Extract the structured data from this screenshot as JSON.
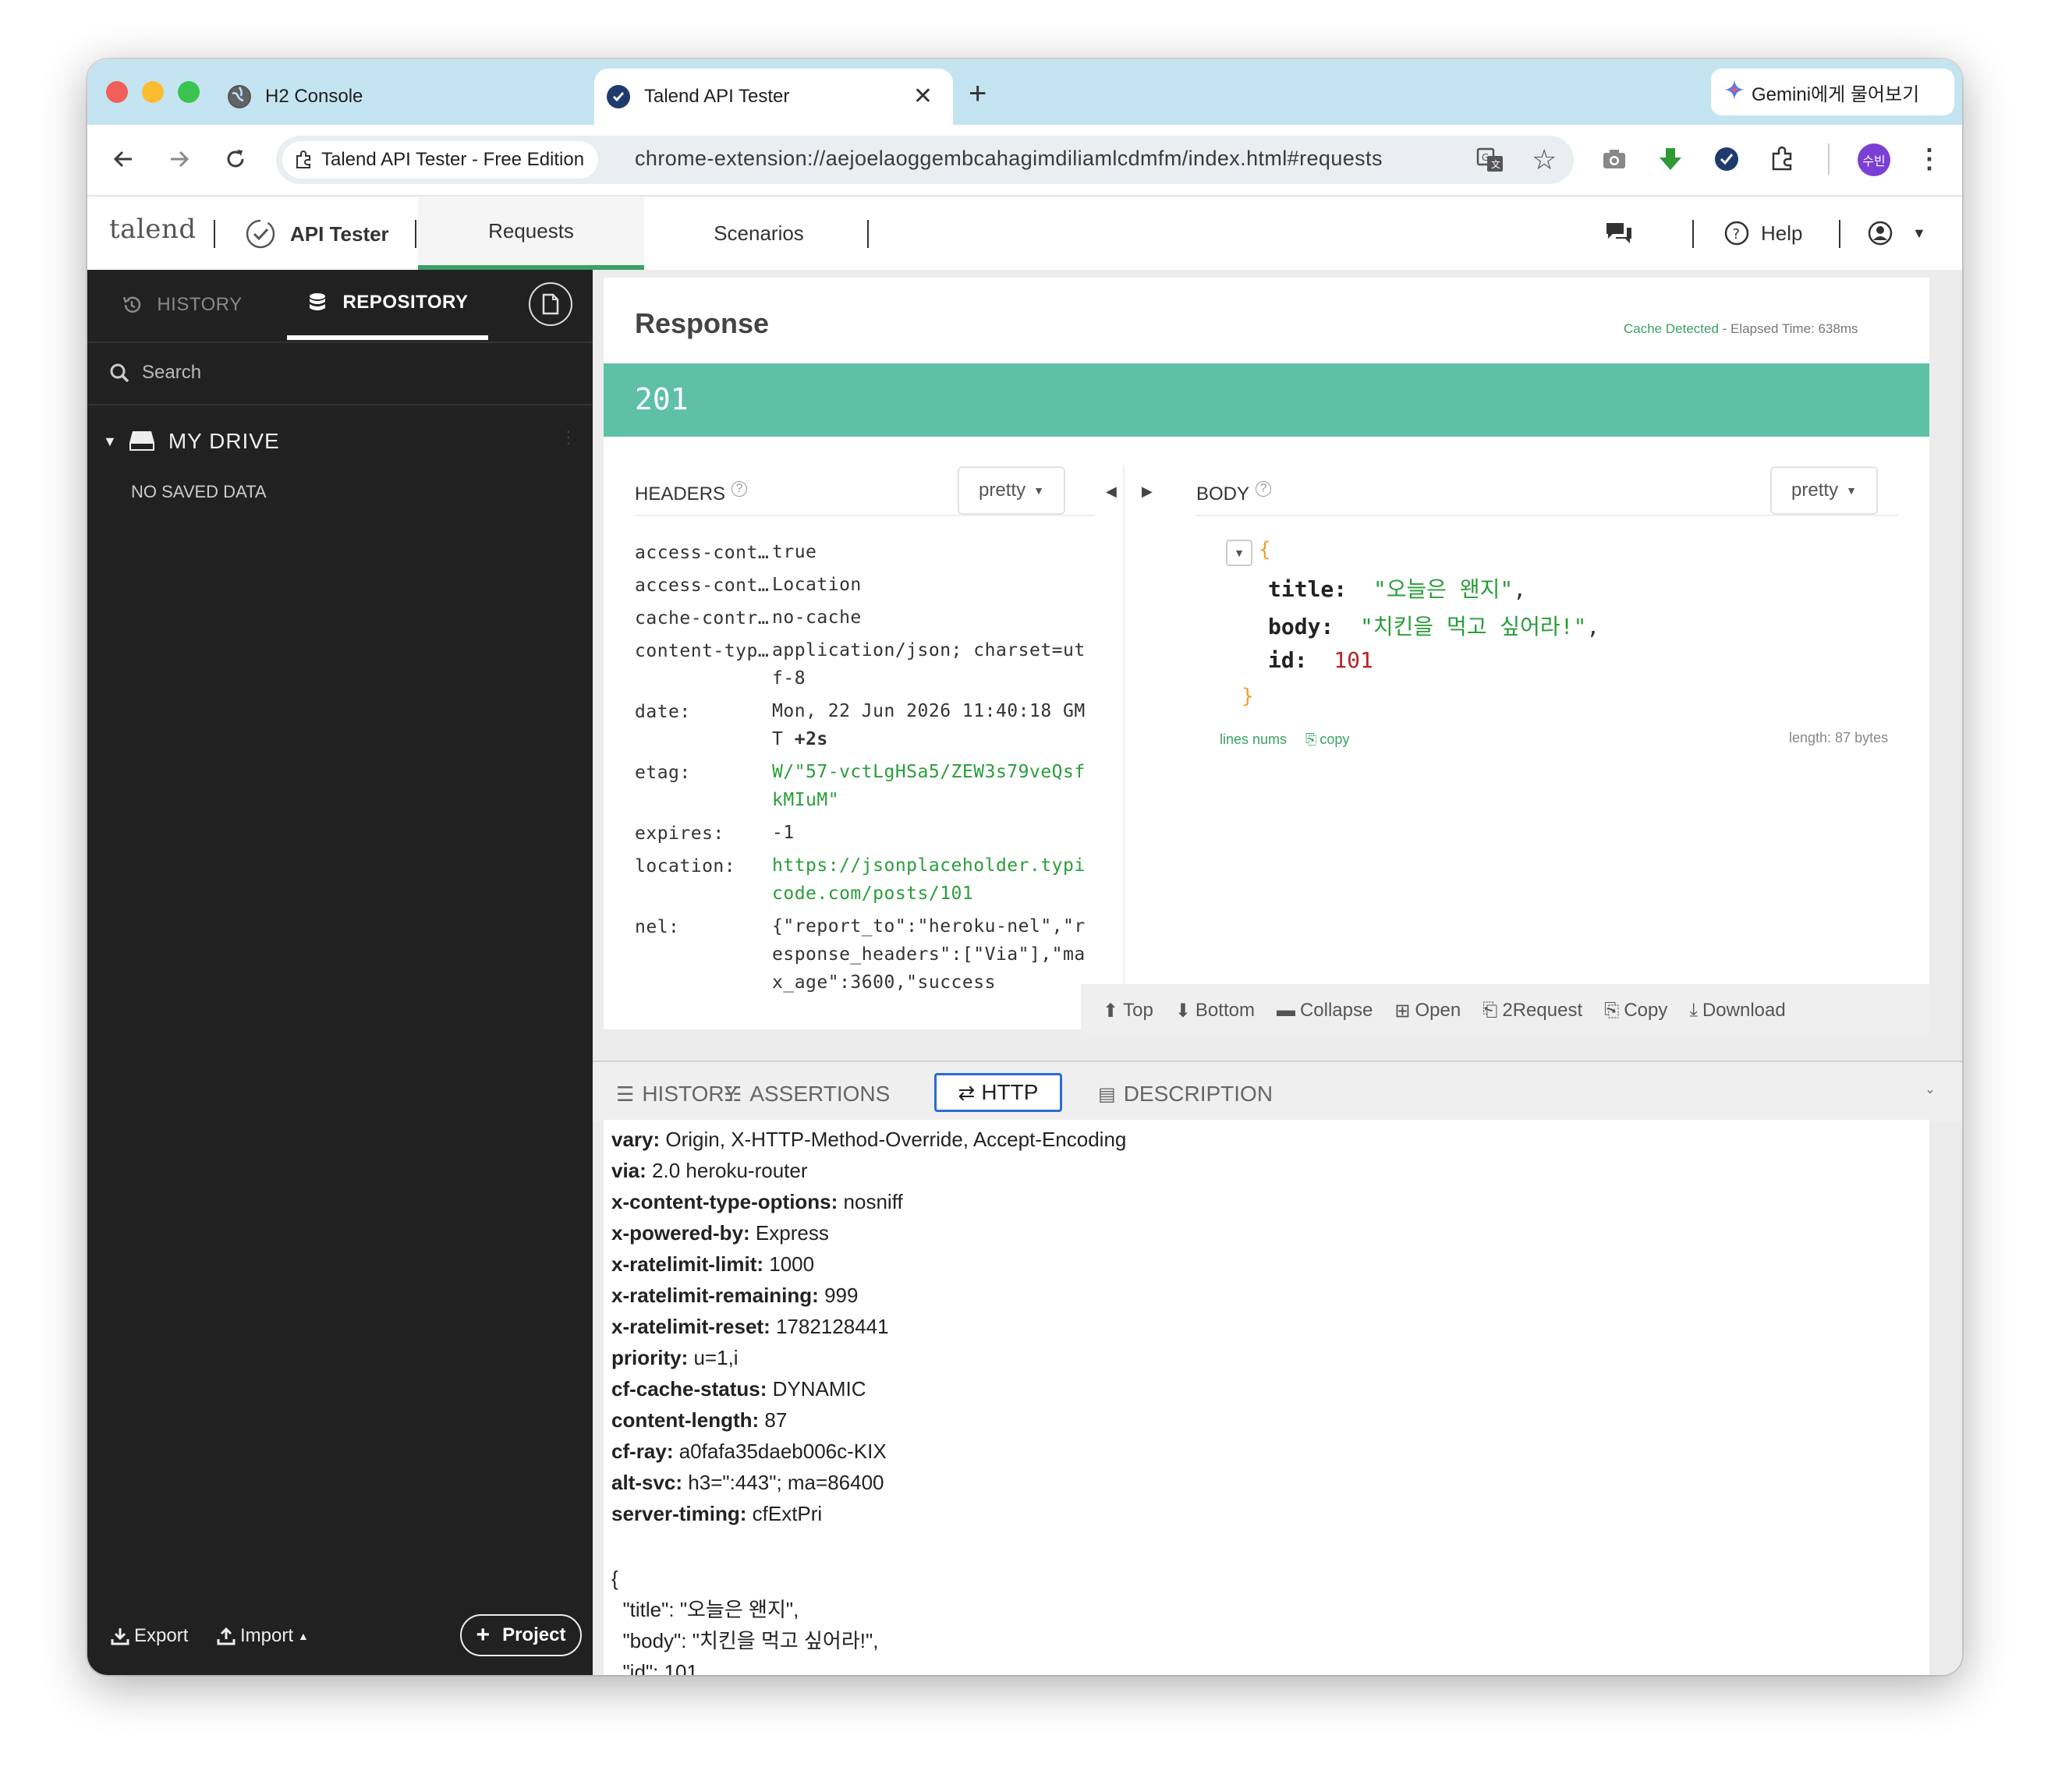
{
  "browser": {
    "tabs": [
      {
        "title": "H2 Console",
        "active": false
      },
      {
        "title": "Talend API Tester",
        "active": true
      }
    ],
    "new_tab": "+",
    "gemini_label": "Gemini에게 물어보기",
    "site_chip": "Talend API Tester - Free Edition",
    "url": "chrome-extension://aejoelaoggembcahagimdiliamlcdmfm/index.html#requests",
    "avatar_text": "수빈",
    "colors": {
      "tab_strip": "#c5e4f1",
      "download_icon": "#2e9a35",
      "avatar": "#7b3fd6"
    }
  },
  "app": {
    "logo": "talend",
    "product": "API Tester",
    "nav": [
      "Requests",
      "Scenarios"
    ],
    "help": "Help",
    "accent": "#3aa067"
  },
  "sidebar": {
    "tabs": [
      "HISTORY",
      "REPOSITORY"
    ],
    "active_tab": "REPOSITORY",
    "search_placeholder": "Search",
    "drive_label": "MY DRIVE",
    "empty_text": "NO SAVED DATA",
    "footer": {
      "export": "Export",
      "import": "Import",
      "project": "Project"
    }
  },
  "response": {
    "title": "Response",
    "cache_detected": "Cache Detected",
    "elapsed": "- Elapsed Time: 638ms",
    "status_code": "201",
    "status_color": "#5ec0a5",
    "headers_label": "HEADERS",
    "body_label": "BODY",
    "headers_format": "pretty",
    "body_format": "pretty",
    "headers": [
      {
        "key": "access-cont…",
        "value": "true"
      },
      {
        "key": "access-cont…",
        "value": "Location"
      },
      {
        "key": "cache-contr…",
        "value": "no-cache"
      },
      {
        "key": "content-typ…",
        "value": "application/json; charset=utf-8"
      },
      {
        "key": "date:",
        "value": "Mon, 22 Jun 2026 11:40:18 GMT",
        "extra": "+2s"
      },
      {
        "key": "etag:",
        "value": "W/\"57-vctLgHSa5/ZEW3s79veQsfkMIuM\""
      },
      {
        "key": "expires:",
        "value": "-1"
      },
      {
        "key": "location:",
        "value": "https://jsonplaceholder.typicode.com/posts/101"
      },
      {
        "key": "nel:",
        "value": "{\"report_to\":\"heroku-nel\",\"response_headers\":[\"Via\"],\"max_age\":3600,\"success"
      }
    ],
    "body_json": {
      "open": "{",
      "close": "}",
      "fields": [
        {
          "key": "title",
          "value": "\"오늘은 왠지\"",
          "sep": ","
        },
        {
          "key": "body",
          "value": "\"치킨을 먹고 싶어라!\"",
          "sep": ","
        },
        {
          "key": "id",
          "value": "101",
          "sep": ""
        }
      ]
    },
    "lines_nums": "lines nums",
    "copy_link": "copy",
    "length": "length: 87 bytes",
    "actions": [
      "Top",
      "Bottom",
      "Collapse",
      "Open",
      "2Request",
      "Copy",
      "Download"
    ]
  },
  "bottom": {
    "tabs": [
      "HISTORY",
      "ASSERTIONS",
      "HTTP",
      "DESCRIPTION"
    ],
    "active_tab": "HTTP",
    "http_headers": [
      {
        "k": "vary:",
        "v": "Origin, X-HTTP-Method-Override, Accept-Encoding"
      },
      {
        "k": "via:",
        "v": "2.0 heroku-router"
      },
      {
        "k": "x-content-type-options:",
        "v": "nosniff"
      },
      {
        "k": "x-powered-by:",
        "v": "Express"
      },
      {
        "k": "x-ratelimit-limit:",
        "v": "1000"
      },
      {
        "k": "x-ratelimit-remaining:",
        "v": "999"
      },
      {
        "k": "x-ratelimit-reset:",
        "v": "1782128441"
      },
      {
        "k": "priority:",
        "v": "u=1,i"
      },
      {
        "k": "cf-cache-status:",
        "v": "DYNAMIC"
      },
      {
        "k": "content-length:",
        "v": "87"
      },
      {
        "k": "cf-ray:",
        "v": "a0fafa35daeb006c-KIX"
      },
      {
        "k": "alt-svc:",
        "v": "h3=\":443\"; ma=86400"
      },
      {
        "k": "server-timing:",
        "v": "cfExtPri"
      }
    ],
    "raw_body": "{\n  \"title\": \"오늘은 왠지\",\n  \"body\": \"치킨을 먹고 싶어라!\",\n  \"id\": 101\n}"
  }
}
